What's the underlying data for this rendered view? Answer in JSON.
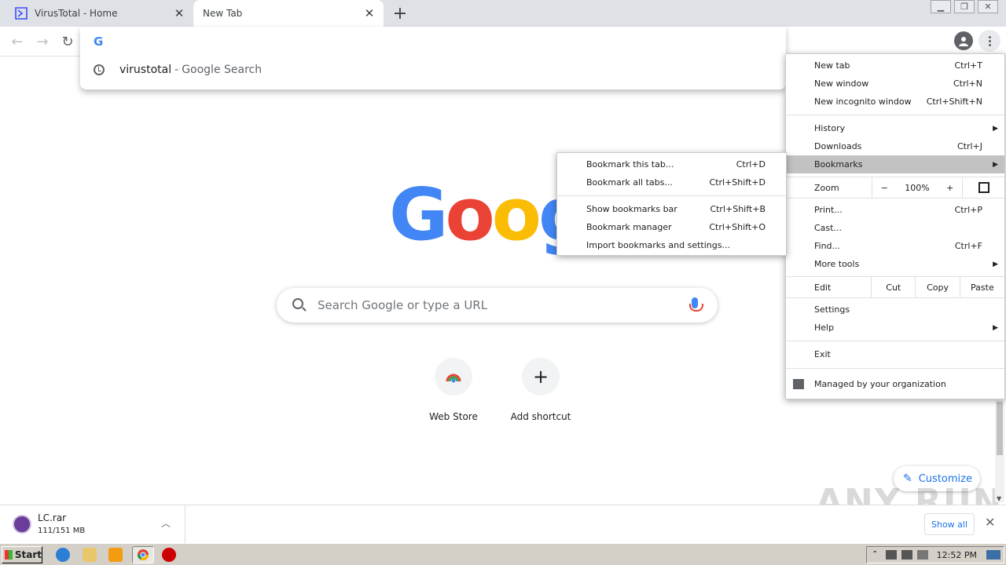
{
  "tabs": [
    {
      "title": "VirusTotal - Home",
      "close": "✕"
    },
    {
      "title": "New Tab",
      "close": "✕"
    }
  ],
  "omnibox": {
    "suggestion_query": "virustotal",
    "suggestion_sep": "-",
    "suggestion_source": "Google Search"
  },
  "ntp": {
    "logo_letters": [
      {
        "ch": "G",
        "color": "#4285f4"
      },
      {
        "ch": "o",
        "color": "#ea4335"
      },
      {
        "ch": "o",
        "color": "#fbbc05"
      },
      {
        "ch": "g",
        "color": "#4285f4"
      }
    ],
    "search_placeholder": "Search Google or type a URL",
    "shortcuts": [
      {
        "label": "Web Store"
      },
      {
        "label": "Add shortcut",
        "icon": "+"
      }
    ],
    "customize": "Customize"
  },
  "menu": {
    "items": [
      {
        "label": "New tab",
        "shortcut": "Ctrl+T"
      },
      {
        "label": "New window",
        "shortcut": "Ctrl+N"
      },
      {
        "label": "New incognito window",
        "shortcut": "Ctrl+Shift+N"
      },
      {
        "label": "History",
        "shortcut": ""
      },
      {
        "label": "Downloads",
        "shortcut": "Ctrl+J"
      },
      {
        "label": "Bookmarks",
        "shortcut": ""
      },
      {
        "label": "Print...",
        "shortcut": "Ctrl+P"
      },
      {
        "label": "Cast...",
        "shortcut": ""
      },
      {
        "label": "Find...",
        "shortcut": "Ctrl+F"
      },
      {
        "label": "More tools",
        "shortcut": ""
      },
      {
        "label": "Settings",
        "shortcut": ""
      },
      {
        "label": "Help",
        "shortcut": ""
      },
      {
        "label": "Exit",
        "shortcut": ""
      }
    ],
    "zoom": {
      "label": "Zoom",
      "minus": "−",
      "value": "100%",
      "plus": "+"
    },
    "edit": {
      "label": "Edit",
      "cut": "Cut",
      "copy": "Copy",
      "paste": "Paste"
    },
    "managed": "Managed by your organization"
  },
  "bookmarks_submenu": {
    "items": [
      {
        "label": "Bookmark this tab...",
        "shortcut": "Ctrl+D"
      },
      {
        "label": "Bookmark all tabs...",
        "shortcut": "Ctrl+Shift+D"
      },
      {
        "label": "Show bookmarks bar",
        "shortcut": "Ctrl+Shift+B"
      },
      {
        "label": "Bookmark manager",
        "shortcut": "Ctrl+Shift+O"
      },
      {
        "label": "Import bookmarks and settings...",
        "shortcut": ""
      }
    ]
  },
  "download": {
    "filename": "LC.rar",
    "progress": "111/151 MB",
    "show_all": "Show all"
  },
  "watermark": "ANY RUN",
  "taskbar": {
    "start": "Start",
    "clock": "12:52 PM"
  }
}
